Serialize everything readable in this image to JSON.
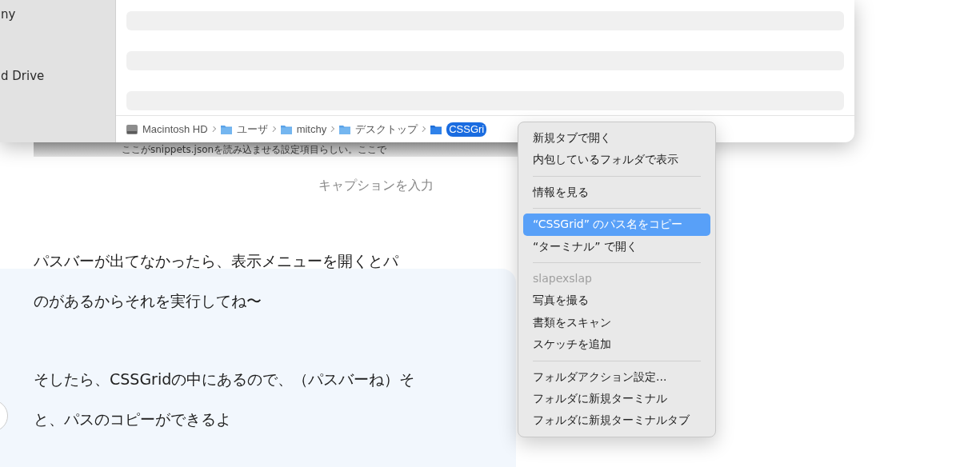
{
  "finder": {
    "sidebar": {
      "items": [
        {
          "label": "ny"
        },
        {
          "label": "d Drive"
        }
      ]
    },
    "path_bar": [
      {
        "label": "Macintosh HD",
        "kind": "disk",
        "selected": false
      },
      {
        "label": "ユーザ",
        "kind": "folder",
        "selected": false
      },
      {
        "label": "mitchy",
        "kind": "folder",
        "selected": false
      },
      {
        "label": "デスクトップ",
        "kind": "folder",
        "selected": false
      },
      {
        "label": "CSSGri",
        "kind": "folder",
        "selected": true
      }
    ]
  },
  "image_caption_strip": "ここがsnippets.jsonを読み込ませる設定項目らしい。ここで",
  "caption_placeholder": "キャプションを入力",
  "body_paragraphs": [
    [
      "パスバーが出てなかったら、表示メニューを開くとパ",
      "のがあるからそれを実行してね〜"
    ],
    [
      "そしたら、CSSGridの中にあるので、（パスバーね）そ",
      "と、パスのコピーができるよ"
    ]
  ],
  "context_menu": {
    "items": [
      {
        "kind": "item",
        "label": "新規タブで開く",
        "selected": false
      },
      {
        "kind": "item",
        "label": "内包しているフォルダで表示",
        "selected": false
      },
      {
        "kind": "separator"
      },
      {
        "kind": "item",
        "label": "情報を見る",
        "selected": false
      },
      {
        "kind": "separator"
      },
      {
        "kind": "item",
        "label": "“CSSGrid” のパス名をコピー",
        "selected": true
      },
      {
        "kind": "item",
        "label": "“ターミナル” で開く",
        "selected": false
      },
      {
        "kind": "separator"
      },
      {
        "kind": "header",
        "label": "slapexslap"
      },
      {
        "kind": "item",
        "label": "写真を撮る",
        "selected": false
      },
      {
        "kind": "item",
        "label": "書類をスキャン",
        "selected": false
      },
      {
        "kind": "item",
        "label": "スケッチを追加",
        "selected": false
      },
      {
        "kind": "separator"
      },
      {
        "kind": "item",
        "label": "フォルダアクション設定...",
        "selected": false
      },
      {
        "kind": "item",
        "label": "フォルダに新規ターミナル",
        "selected": false
      },
      {
        "kind": "item",
        "label": "フォルダに新規ターミナルタブ",
        "selected": false
      }
    ]
  }
}
